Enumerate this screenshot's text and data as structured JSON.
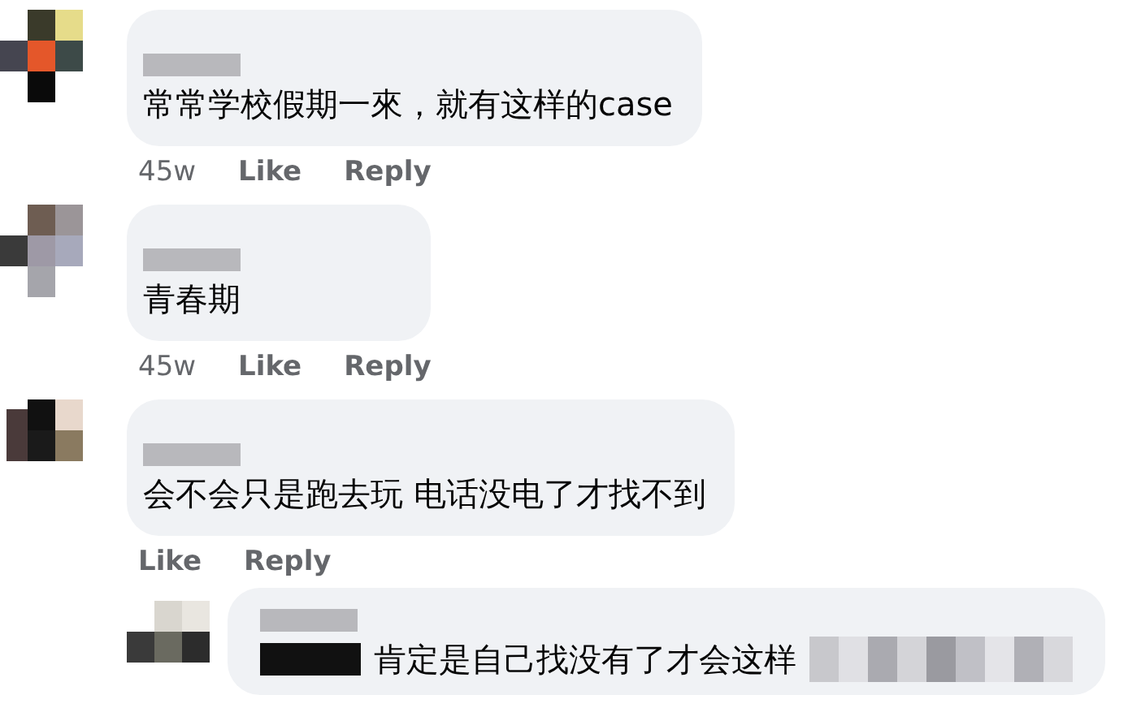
{
  "comments": [
    {
      "text": "常常学校假期一來，就有这样的case",
      "time": "45w",
      "like": "Like",
      "reply": "Reply"
    },
    {
      "text": "青春期",
      "time": "45w",
      "like": "Like",
      "reply": "Reply"
    },
    {
      "text": "会不会只是跑去玩 电话没电了才找不到",
      "like": "Like",
      "reply": "Reply",
      "replies": [
        {
          "text": "肯定是自己找没有了才会这样"
        }
      ]
    }
  ]
}
